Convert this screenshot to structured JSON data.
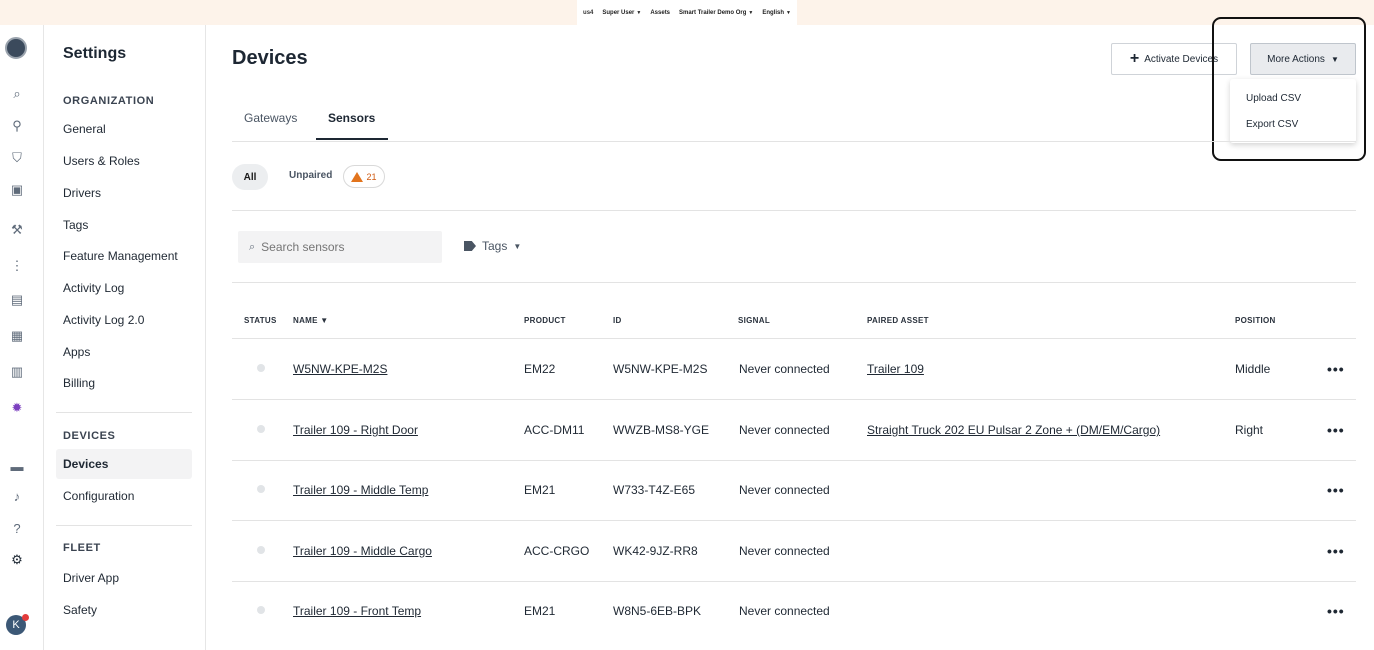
{
  "topbar": {
    "region": "us4",
    "user": "Super User",
    "assets": "Assets",
    "org": "Smart Trailer Demo Org",
    "language": "English"
  },
  "sidebar": {
    "title": "Settings",
    "organization_heading": "ORGANIZATION",
    "organization_items": [
      "General",
      "Users & Roles",
      "Drivers",
      "Tags",
      "Feature Management",
      "Activity Log",
      "Activity Log 2.0",
      "Apps",
      "Billing"
    ],
    "devices_heading": "DEVICES",
    "devices_items": [
      "Devices",
      "Configuration"
    ],
    "fleet_heading": "FLEET",
    "fleet_items": [
      "Driver App",
      "Safety"
    ]
  },
  "rail": {
    "avatar_initial": "K",
    "icons": [
      "search-icon",
      "map-pin-icon",
      "shield-icon",
      "clipboard-icon",
      "wrench-icon",
      "route-icon",
      "fuel-icon",
      "document-icon",
      "bar-chart-icon",
      "bug-icon",
      "message-icon",
      "bell-icon",
      "help-icon",
      "gear-icon"
    ]
  },
  "main": {
    "title": "Devices",
    "activate_button": "Activate Devices",
    "more_actions_button": "More Actions",
    "dropdown": {
      "upload": "Upload CSV",
      "export": "Export CSV"
    },
    "tabs": [
      "Gateways",
      "Sensors"
    ],
    "filter_all": "All",
    "filter_unpaired": "Unpaired",
    "unpaired_count": "21",
    "search_placeholder": "Search sensors",
    "tags_filter": "Tags",
    "columns": {
      "status": "STATUS",
      "name": "NAME ▼",
      "product": "PRODUCT",
      "id": "ID",
      "signal": "SIGNAL",
      "paired_asset": "PAIRED ASSET",
      "position": "POSITION"
    },
    "rows": [
      {
        "name": "W5NW-KPE-M2S",
        "product": "EM22",
        "id": "W5NW-KPE-M2S",
        "signal": "Never connected",
        "paired_asset": "Trailer 109",
        "position": "Middle"
      },
      {
        "name": "Trailer 109 - Right Door",
        "product": "ACC-DM11",
        "id": "WWZB-MS8-YGE",
        "signal": "Never connected",
        "paired_asset": "Straight Truck 202 EU Pulsar 2 Zone + (DM/EM/Cargo)",
        "position": "Right"
      },
      {
        "name": "Trailer 109 - Middle Temp",
        "product": "EM21",
        "id": "W733-T4Z-E65",
        "signal": "Never connected",
        "paired_asset": "",
        "position": ""
      },
      {
        "name": "Trailer 109 - Middle Cargo",
        "product": "ACC-CRGO",
        "id": "WK42-9JZ-RR8",
        "signal": "Never connected",
        "paired_asset": "",
        "position": ""
      },
      {
        "name": "Trailer 109 - Front Temp",
        "product": "EM21",
        "id": "W8N5-6EB-BPK",
        "signal": "Never connected",
        "paired_asset": "",
        "position": ""
      }
    ]
  }
}
